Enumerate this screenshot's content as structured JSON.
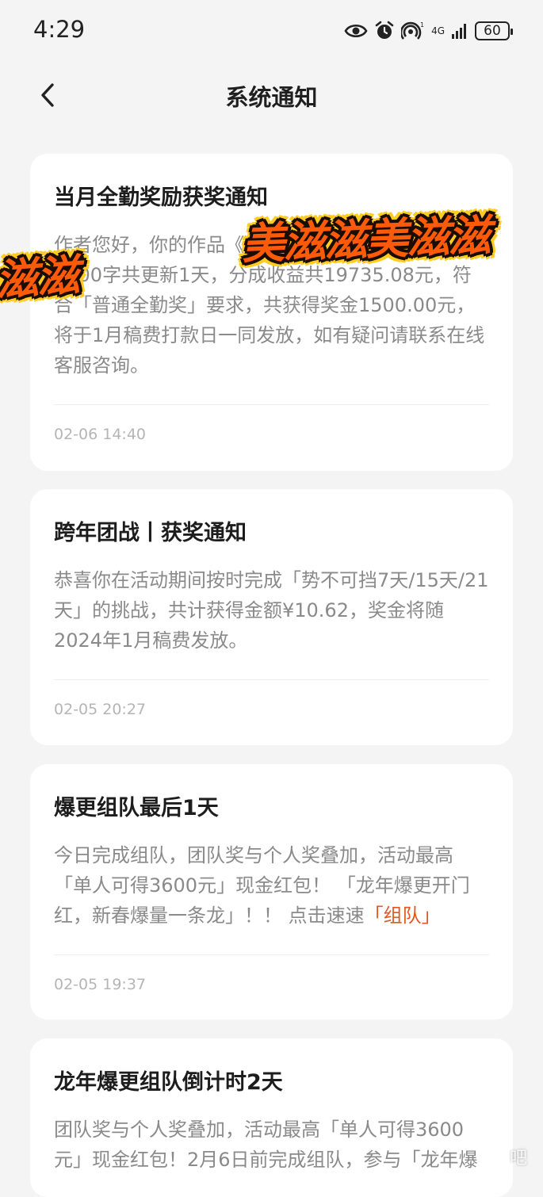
{
  "status_bar": {
    "time": "4:29",
    "network_label": "4G",
    "battery": "60"
  },
  "header": {
    "title": "系统通知"
  },
  "notifications": [
    {
      "title": "当月全勤奖励获奖通知",
      "body": "作者您好，你的作品《》1月4000字共更新31天，6000字共更新1天，分成收益共19735.08元，符合「普通全勤奖」要求，共获得奖金1500.00元，将于1月稿费打款日一同发放，如有疑问请联系在线客服咨询。",
      "time": "02-06 14:40"
    },
    {
      "title": "跨年团战丨获奖通知",
      "body": "恭喜你在活动期间按时完成「势不可挡7天/15天/21天」的挑战，共计获得金额¥10.62，奖金将随2024年1月稿费发放。",
      "time": "02-05 20:27"
    },
    {
      "title": "爆更组队最后1天",
      "body": "今日完成组队，团队奖与个人奖叠加，活动最高「单人可得3600元」现金红包！ 「龙年爆更开门红，新春爆量一条龙」！！ 点击速速",
      "link": "「组队」",
      "time": "02-05 19:37"
    },
    {
      "title": "龙年爆更组队倒计时2天",
      "body": "团队奖与个人奖叠加，活动最高「单人可得3600元」现金红包！2月6日前完成组队，参与「龙年爆"
    }
  ],
  "stickers": {
    "right": "美滋滋美滋滋",
    "left": "滋滋"
  },
  "watermark": "吧",
  "colors": {
    "background": "#f4f4f4",
    "card": "#ffffff",
    "link": "#e2561f",
    "sticker": "#ff5a08"
  }
}
